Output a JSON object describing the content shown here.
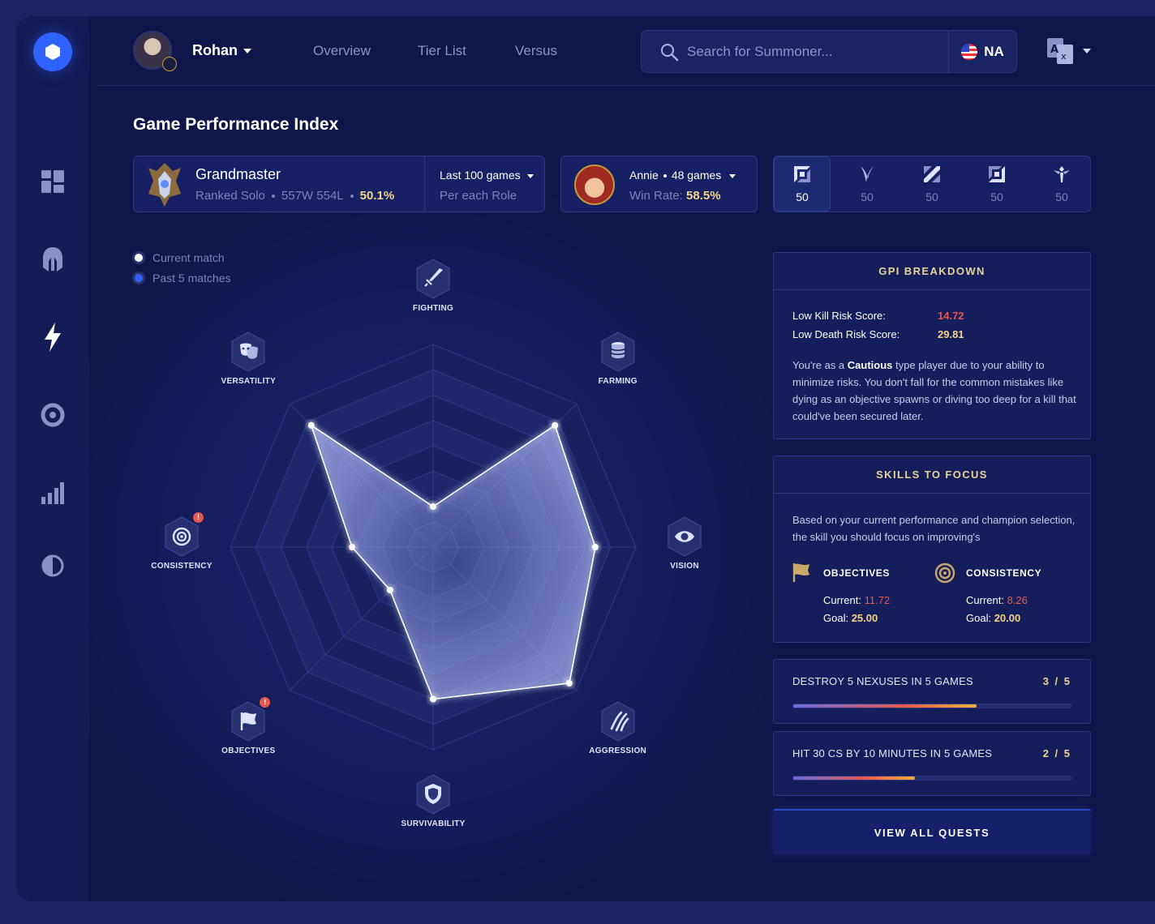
{
  "user": {
    "name": "Rohan"
  },
  "nav_tabs": [
    {
      "label": "Overview"
    },
    {
      "label": "Tier List"
    },
    {
      "label": "Versus"
    }
  ],
  "search": {
    "placeholder": "Search for Summoner...",
    "region": "NA"
  },
  "page_title": "Game Performance Index",
  "rank": {
    "tier": "Grandmaster",
    "queue": "Ranked Solo",
    "record": "557W 554L",
    "winrate": "50.1%"
  },
  "games_filter": {
    "selected": "Last 100 games",
    "sub": "Per each Role"
  },
  "champion": {
    "name": "Annie",
    "games": "48 games",
    "winrate_label": "Win Rate:",
    "winrate": "58.5%"
  },
  "roles": [
    {
      "icon": "top-lane-icon",
      "value": "50"
    },
    {
      "icon": "jungle-icon",
      "value": "50"
    },
    {
      "icon": "mid-lane-icon",
      "value": "50"
    },
    {
      "icon": "bottom-lane-icon",
      "value": "50"
    },
    {
      "icon": "support-icon",
      "value": "50"
    }
  ],
  "legend": [
    {
      "label": "Current match",
      "color": "#ffffff"
    },
    {
      "label": "Past 5 matches",
      "color": "#2f63ff"
    }
  ],
  "radar": {
    "axes": [
      {
        "label": "FIGHTING",
        "icon": "sword-icon",
        "value": 0.2,
        "alert": false
      },
      {
        "label": "FARMING",
        "icon": "coins-icon",
        "value": 0.85,
        "alert": false
      },
      {
        "label": "VISION",
        "icon": "eye-icon",
        "value": 0.8,
        "alert": false
      },
      {
        "label": "AGGRESSION",
        "icon": "claw-icon",
        "value": 0.95,
        "alert": false
      },
      {
        "label": "SURVIVABILITY",
        "icon": "shield-icon",
        "value": 0.75,
        "alert": false
      },
      {
        "label": "OBJECTIVES",
        "icon": "flag-icon",
        "value": 0.3,
        "alert": true
      },
      {
        "label": "CONSISTENCY",
        "icon": "target-icon",
        "value": 0.4,
        "alert": true
      },
      {
        "label": "VERSATILITY",
        "icon": "masks-icon",
        "value": 0.85,
        "alert": false
      }
    ]
  },
  "gpi_breakdown": {
    "title": "GPI BREAKDOWN",
    "rows": [
      {
        "label": "Low Kill Risk Score:",
        "value": "14.72",
        "color": "#e8574e"
      },
      {
        "label": "Low Death Risk Score:",
        "value": "29.81",
        "color": "#f2d58b"
      }
    ],
    "text_pre": "You're as a ",
    "text_bold": "Cautious",
    "text_post": " type player due to your ability to minimize risks. You don't fall for the common mistakes like dying as an objective spawns or diving too deep for a kill that could've been secured later."
  },
  "skills_focus": {
    "title": "SKILLS TO FOCUS",
    "description": "Based on your current performance and champion selection, the skill you should focus on improving's",
    "skills": [
      {
        "name": "OBJECTIVES",
        "icon": "flag-icon",
        "current_label": "Current:",
        "current": "11.72",
        "goal_label": "Goal:",
        "goal": "25.00"
      },
      {
        "name": "CONSISTENCY",
        "icon": "target-icon",
        "current_label": "Current:",
        "current": "8.26",
        "goal_label": "Goal:",
        "goal": "20.00"
      }
    ]
  },
  "quests": [
    {
      "title": "DESTROY 5 NEXUSES IN 5 GAMES",
      "count": "3 / 5",
      "progress": 0.66
    },
    {
      "title": "HIT 30 CS BY 10 MINUTES IN 5 GAMES",
      "count": "2 / 5",
      "progress": 0.44
    }
  ],
  "quests_button": "VIEW ALL QUESTS",
  "colors": {
    "accent": "#2f63ff",
    "gold": "#f2d58b",
    "alert": "#e8574e"
  }
}
